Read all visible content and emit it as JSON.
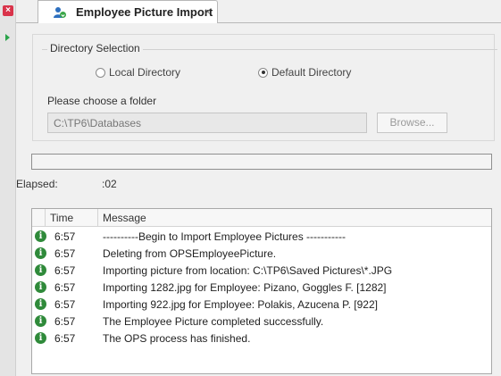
{
  "tab": {
    "title": "Employee Picture Import",
    "close": "×"
  },
  "directory": {
    "group_label": "Directory Selection",
    "options": [
      {
        "label": "Local Directory",
        "selected": false
      },
      {
        "label": "Default Directory",
        "selected": true
      }
    ],
    "folder_prompt": "Please choose a folder",
    "folder_value": "C:\\TP6\\Databases",
    "browse_label": "Browse..."
  },
  "progress": {
    "fraction": 0
  },
  "elapsed": {
    "label": "Elapsed:",
    "value": ":02"
  },
  "log": {
    "columns": {
      "time": "Time",
      "message": "Message"
    },
    "rows": [
      {
        "time": "6:57",
        "message": "----------Begin to Import Employee Pictures -----------"
      },
      {
        "time": "6:57",
        "message": "Deleting from OPSEmployeePicture."
      },
      {
        "time": "6:57",
        "message": "Importing picture from location: C:\\TP6\\Saved Pictures\\*.JPG"
      },
      {
        "time": "6:57",
        "message": "Importing 1282.jpg for Employee: Pizano, Goggles F. [1282]"
      },
      {
        "time": "6:57",
        "message": "Importing 922.jpg for Employee: Polakis, Azucena P. [922]"
      },
      {
        "time": "6:57",
        "message": "The Employee Picture completed successfully."
      },
      {
        "time": "6:57",
        "message": "The OPS process has finished."
      }
    ]
  },
  "colors": {
    "info_icon": "#2f8a3a",
    "close_badge": "#d9334a",
    "play_arrow": "#2aa34a"
  },
  "icons": {
    "close": "close-icon",
    "play": "play-icon",
    "tab": "employee-picture-icon",
    "info": "info-icon"
  }
}
